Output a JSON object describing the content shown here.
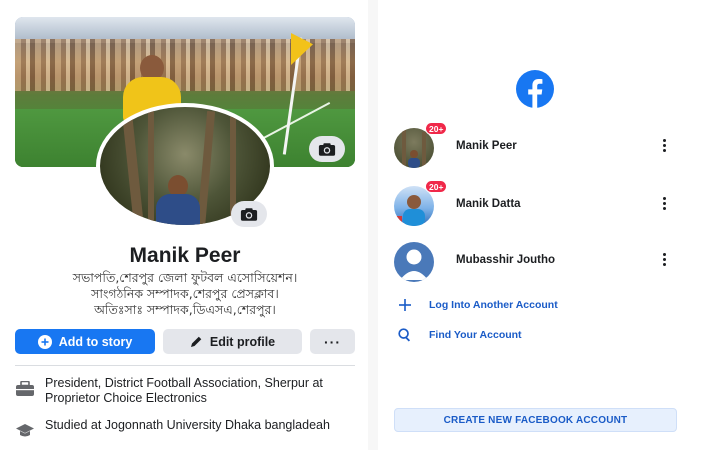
{
  "profile": {
    "name": "Manik Peer",
    "bio": [
      "সভাপতি,শেরপুর জেলা ফুটবল এসোসিয়েশন।",
      "সাংগঠনিক সম্পাদক,শেরপুর প্রেসক্লাব।",
      "অতিঃসাঃ সম্পাদক,ডিএসএ,শেরপুর।"
    ],
    "buttons": {
      "add_story": "Add to story",
      "edit_profile": "Edit profile",
      "more": "···"
    },
    "info": {
      "work": "President, District Football Association, Sherpur at Proprietor Choice Electronics",
      "education": "Studied at Jogonnath University Dhaka bangladeah"
    }
  },
  "accounts_screen": {
    "logo_icon": "facebook-logo-icon",
    "accounts": [
      {
        "name": "Manik Peer",
        "badge": "20+"
      },
      {
        "name": "Manik Datta",
        "badge": "20+"
      },
      {
        "name": "Mubasshir Joutho",
        "badge": ""
      }
    ],
    "log_into_another": "Log Into Another Account",
    "find_account": "Find Your Account",
    "create_new": "CREATE NEW FACEBOOK ACCOUNT"
  },
  "colors": {
    "brand_blue": "#1877f2",
    "link_blue": "#1a5bc7",
    "badge_red": "#f02849",
    "button_gray": "#e4e6eb"
  }
}
